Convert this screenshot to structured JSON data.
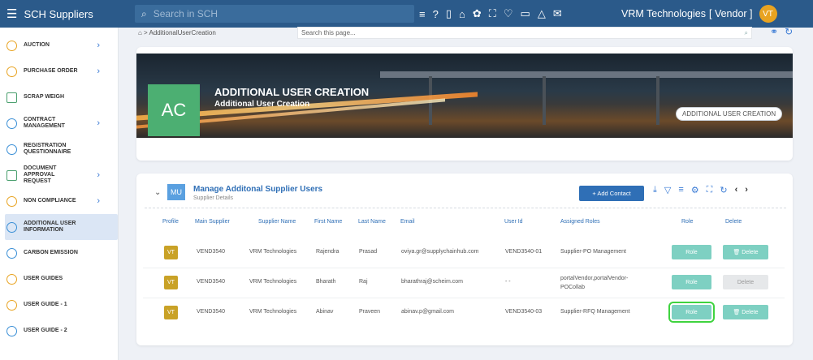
{
  "app": {
    "title": "SCH Suppliers",
    "search_placeholder": "Search in SCH",
    "company": "VRM Technologies",
    "role_tag": "[ Vendor ]",
    "avatar": "VT"
  },
  "breadcrumb": {
    "path": "⌂ > AdditionalUserCreation",
    "search_placeholder": "Search this page..."
  },
  "sidebar": {
    "items": [
      {
        "label": "AUCTION",
        "has_children": true
      },
      {
        "label": "PURCHASE ORDER",
        "has_children": true
      },
      {
        "label": "SCRAP WEIGH",
        "has_children": false
      },
      {
        "label": "CONTRACT MANAGEMENT",
        "has_children": true
      },
      {
        "label": "REGISTRATION QUESTIONNAIRE",
        "has_children": false
      },
      {
        "label": "DOCUMENT APPROVAL REQUEST",
        "has_children": true
      },
      {
        "label": "NON COMPLIANCE",
        "has_children": true
      },
      {
        "label": "ADDITIONAL USER INFORMATION",
        "has_children": false,
        "active": true
      },
      {
        "label": "CARBON EMISSION",
        "has_children": false
      },
      {
        "label": "USER GUIDES",
        "has_children": false
      },
      {
        "label": "USER GUIDE - 1",
        "has_children": false
      },
      {
        "label": "USER GUIDE - 2",
        "has_children": false
      }
    ]
  },
  "banner": {
    "initials": "AC",
    "title": "ADDITIONAL USER CREATION",
    "subtitle": "Additional User Creation",
    "pill": "ADDITIONAL USER CREATION"
  },
  "panel": {
    "badge": "MU",
    "title": "Manage Additonal Supplier Users",
    "subtitle": "Supplier Details",
    "add_button": "+ Add Contact",
    "columns": [
      "Profile",
      "Main Supplier",
      "Supplier Name",
      "First Name",
      "Last Name",
      "Email",
      "User Id",
      "Assigned Roles",
      "Role",
      "Delete"
    ],
    "rows": [
      {
        "profile": "VT",
        "main_supplier": "VEND3540",
        "supplier_name": "VRM Technologies",
        "first_name": "Rajendra",
        "last_name": "Prasad",
        "email": "oviya.gr@supplychainhub.com",
        "user_id": "VEND3540-01",
        "roles_line1": "Supplier-PO Management",
        "roles_line2": "",
        "role_btn": "Role",
        "delete_btn": "🗑 Delete",
        "delete_enabled": true
      },
      {
        "profile": "VT",
        "main_supplier": "VEND3540",
        "supplier_name": "VRM Technologies",
        "first_name": "Bharath",
        "last_name": "Raj",
        "email": "bharathraj@scheim.com",
        "user_id": "- -",
        "roles_line1": "portalVendor,portalVendor-",
        "roles_line2": "POCollab",
        "role_btn": "Role",
        "delete_btn": "Delete",
        "delete_enabled": false
      },
      {
        "profile": "VT",
        "main_supplier": "VEND3540",
        "supplier_name": "VRM Technologies",
        "first_name": "Abinav",
        "last_name": "Praveen",
        "email": "abinav.p@gmail.com",
        "user_id": "VEND3540-03",
        "roles_line1": "Supplier-RFQ Management",
        "roles_line2": "",
        "role_btn": "Role",
        "delete_btn": "🗑 Delete",
        "delete_enabled": true
      }
    ]
  }
}
